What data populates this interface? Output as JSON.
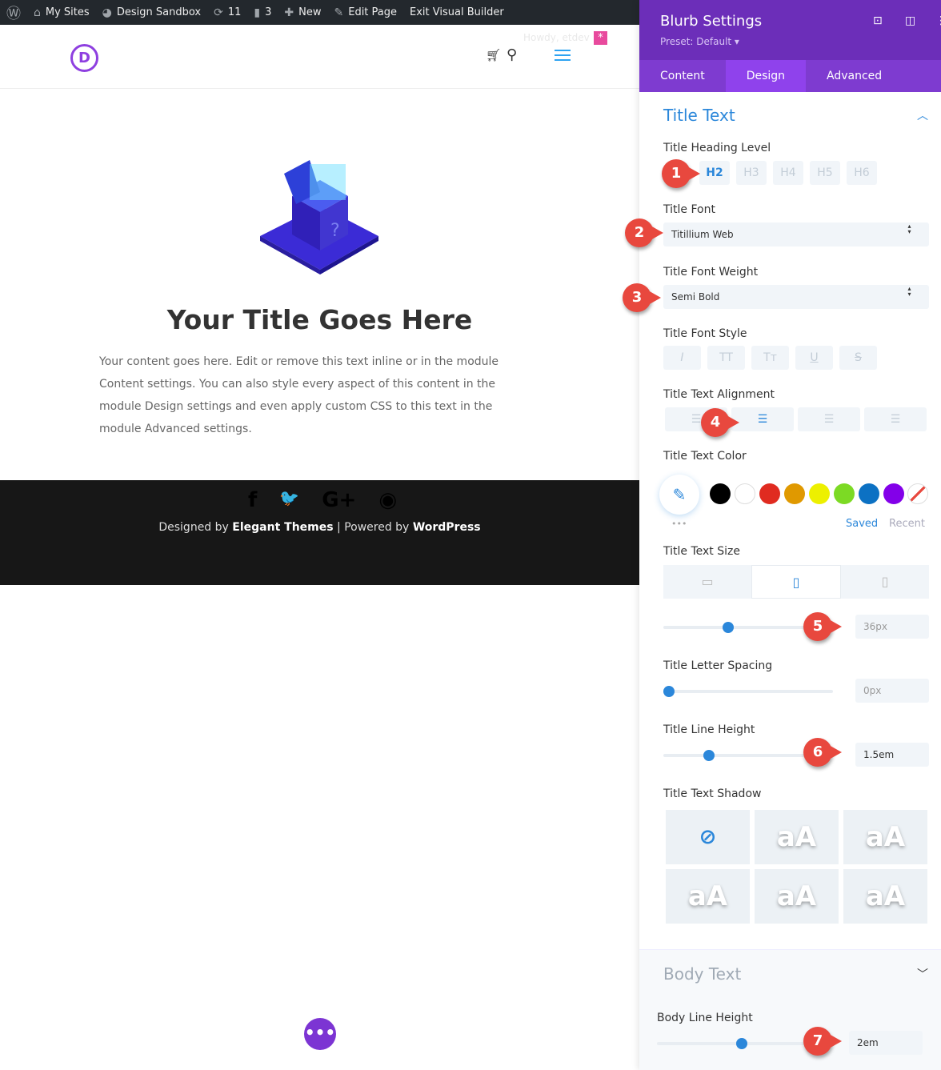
{
  "adminbar": {
    "items": [
      {
        "icon": "wordpress-icon",
        "label": ""
      },
      {
        "icon": "my-sites-icon",
        "label": "My Sites"
      },
      {
        "icon": "dashboard-icon",
        "label": "Design Sandbox"
      },
      {
        "icon": "updates-icon",
        "label": "11"
      },
      {
        "icon": "comments-icon",
        "label": "3"
      },
      {
        "icon": "plus-icon",
        "label": "New"
      },
      {
        "icon": "pencil-icon",
        "label": "Edit Page"
      },
      {
        "icon": "",
        "label": "Exit Visual Builder"
      }
    ]
  },
  "header": {
    "logo": "D",
    "howdy": "Howdy, etdev"
  },
  "page": {
    "title": "Your Title Goes Here",
    "body": "Your content goes here. Edit or remove this text inline or in the module Content settings. You can also style every aspect of this content in the module Design settings and even apply custom CSS to this text in the module Advanced settings."
  },
  "footer": {
    "social": [
      "f",
      "🐦",
      "G+",
      "◉"
    ],
    "designed_by": "Designed by",
    "elegant": "Elegant Themes",
    "sep": "|",
    "powered_by": "Powered by",
    "wordpress": "WordPress"
  },
  "panel": {
    "title": "Blurb Settings",
    "preset": "Preset: Default ▾",
    "tabs": [
      "Content",
      "Design",
      "Advanced"
    ],
    "active_tab": "Design",
    "section": "Title Text",
    "heading_label": "Title Heading Level",
    "headings": [
      "H2",
      "H3",
      "H4",
      "H5",
      "H6"
    ],
    "heading_selected": "H2",
    "font_label": "Title Font",
    "font_value": "Titillium Web",
    "weight_label": "Title Font Weight",
    "weight_value": "Semi Bold",
    "style_label": "Title Font Style",
    "styles": [
      "I",
      "TT",
      "Tт",
      "U",
      "S"
    ],
    "align_label": "Title Text Alignment",
    "align_selected": "center",
    "color_label": "Title Text Color",
    "swatches": [
      "#000000",
      "#ffffff",
      "#e02b20",
      "#e09900",
      "#edf000",
      "#7cda24",
      "#0c71c3",
      "#8300e9"
    ],
    "saved": "Saved",
    "recent": "Recent",
    "more": "•••",
    "size_label": "Title Text Size",
    "size_value": "36px",
    "size_level": 0.38,
    "spacing_label": "Title Letter Spacing",
    "spacing_value": "0px",
    "spacing_level": 0,
    "lh_label": "Title Line Height",
    "lh_value": "1.5em",
    "lh_level": 0.27,
    "shadow_label": "Title Text Shadow",
    "shadow_sample": "aA",
    "body_section": "Body Text",
    "body_lh_label": "Body Line Height",
    "body_lh_value": "2em",
    "body_lh_level": 0.5,
    "callouts": [
      "1",
      "2",
      "3",
      "4",
      "5",
      "6",
      "7"
    ]
  },
  "colors": {
    "accent": "#2b87da",
    "panel_header": "#6c2eb9",
    "callout": "#e8483e"
  }
}
